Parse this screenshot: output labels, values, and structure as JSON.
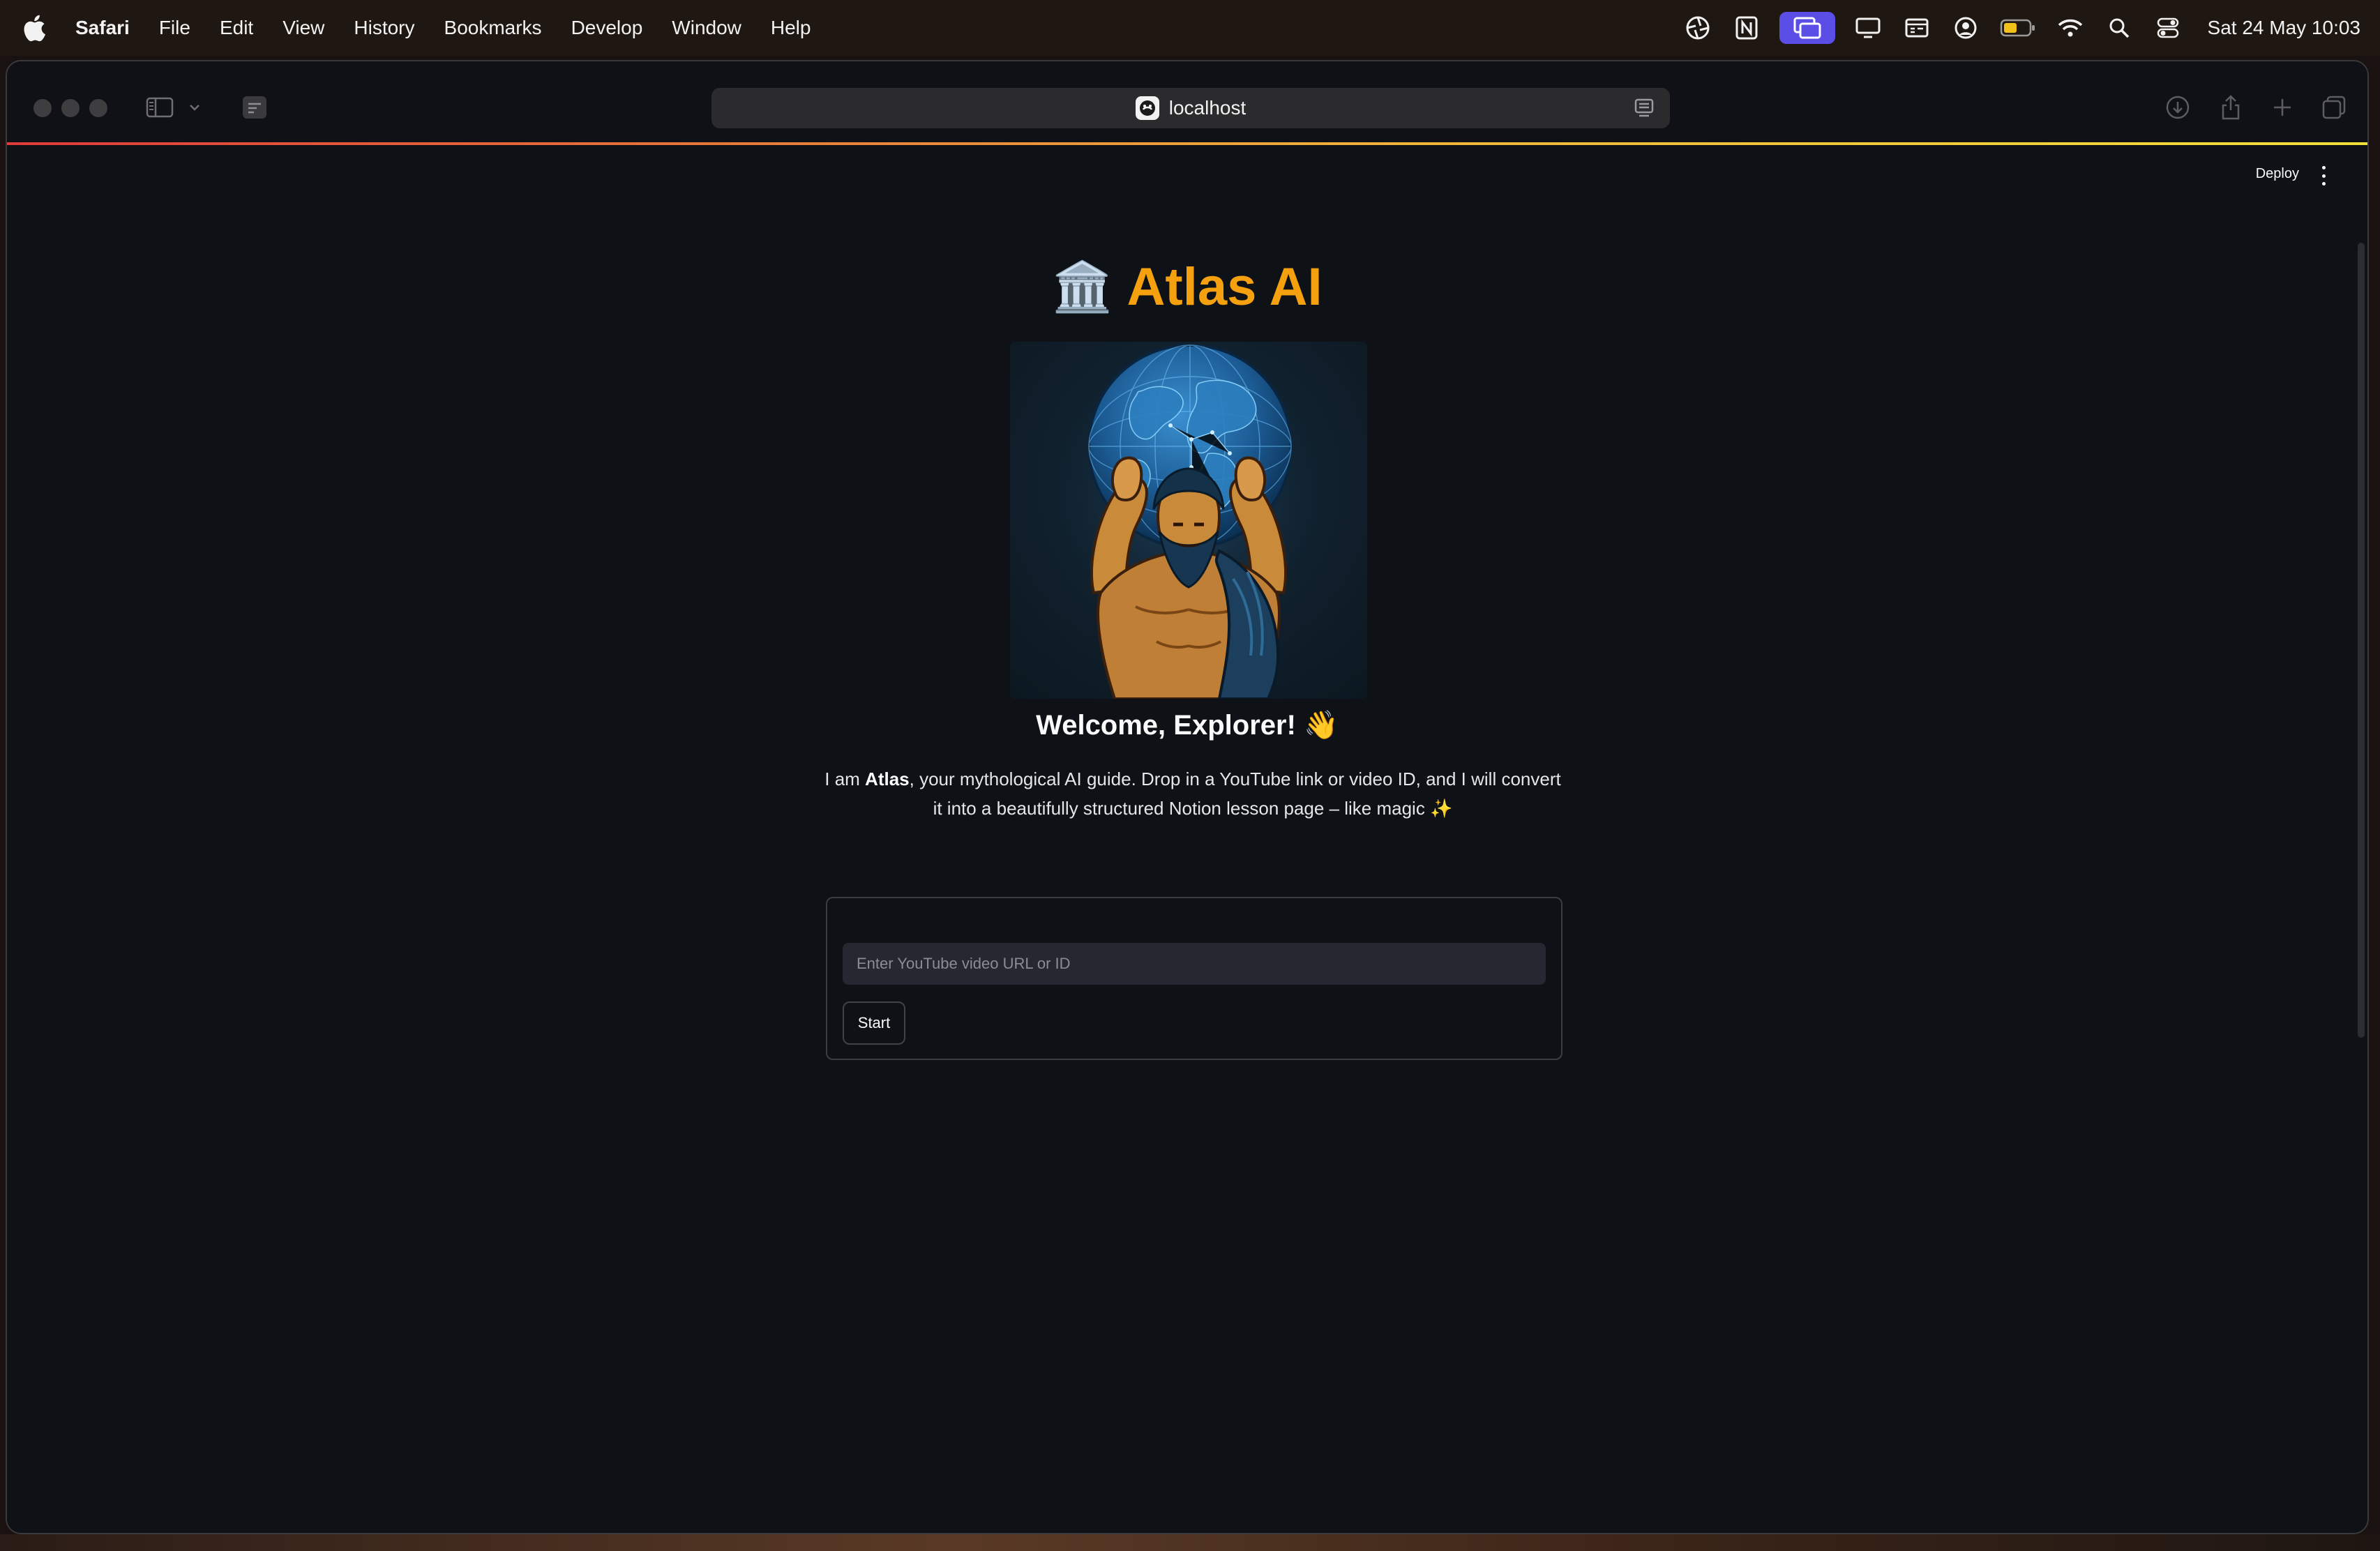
{
  "menubar": {
    "app_name": "Safari",
    "items": [
      "File",
      "Edit",
      "View",
      "History",
      "Bookmarks",
      "Develop",
      "Window",
      "Help"
    ],
    "clock": "Sat 24 May  10:03",
    "tray_icons": [
      "aperture-icon",
      "notion-icon",
      "screen-mirror-icon",
      "display-icon",
      "calendar-card-icon",
      "user-circle-icon",
      "battery-icon",
      "wifi-icon",
      "spotlight-search-icon",
      "control-center-icon"
    ]
  },
  "browser": {
    "address": "localhost",
    "toolbar_icons": [
      "sidebar-icon",
      "chevron-down-icon",
      "tab-overview-icon",
      "reader-icon",
      "download-icon",
      "share-icon",
      "new-tab-icon",
      "tabs-icon"
    ]
  },
  "streamlit": {
    "deploy_label": "Deploy"
  },
  "page": {
    "title_emoji": "🏛️",
    "title": "Atlas AI",
    "welcome": "Welcome, Explorer! 👋",
    "desc_prefix": "I am ",
    "desc_name": "Atlas",
    "desc_suffix": ", your mythological AI guide. Drop in a YouTube link or video ID, and I will convert it into a beautifully structured Notion lesson page – like magic ✨",
    "input_placeholder": "Enter YouTube video URL or ID",
    "start_label": "Start"
  },
  "colors": {
    "accent": "#f5a10f",
    "background": "#0e1116",
    "input_bg": "#262730"
  }
}
